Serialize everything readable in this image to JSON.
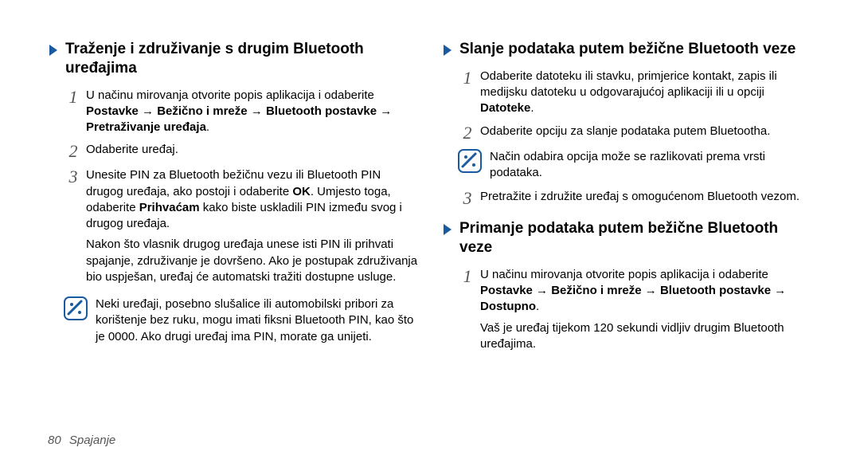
{
  "left": {
    "heading": "Traženje i združivanje s drugim Bluetooth uređajima",
    "steps": [
      {
        "num": "1",
        "body": [
          {
            "plain": "U načinu mirovanja otvorite popis aplikacija i odaberite "
          },
          {
            "bold": "Postavke"
          },
          {
            "plain": " "
          },
          {
            "arrow": "→"
          },
          {
            "plain": " "
          },
          {
            "bold": "Bežično i mreže"
          },
          {
            "plain": " "
          },
          {
            "arrow": "→"
          },
          {
            "plain": " "
          },
          {
            "bold": "Bluetooth postavke"
          },
          {
            "plain": " "
          },
          {
            "arrow": "→"
          },
          {
            "plain": " "
          },
          {
            "bold": "Pretraživanje uređaja"
          },
          {
            "plain": "."
          }
        ]
      },
      {
        "num": "2",
        "body": [
          {
            "plain": "Odaberite uređaj."
          }
        ]
      },
      {
        "num": "3",
        "body": [
          {
            "plain": "Unesite PIN za Bluetooth bežičnu vezu ili Bluetooth PIN drugog uređaja, ako postoji i odaberite "
          },
          {
            "bold": "OK"
          },
          {
            "plain": ". Umjesto toga, odaberite "
          },
          {
            "bold": "Prihvaćam"
          },
          {
            "plain": " kako biste uskladili PIN između svog i drugog uređaja."
          }
        ],
        "extra": "Nakon što vlasnik drugog uređaja unese isti PIN ili prihvati spajanje, združivanje je dovršeno. Ako je postupak združivanja bio uspješan, uređaj će automatski tražiti dostupne usluge."
      }
    ],
    "note": "Neki uređaji, posebno slušalice ili automobilski pribori za korištenje bez ruku, mogu imati fiksni Bluetooth PIN, kao što je 0000. Ako drugi uređaj ima PIN, morate ga unijeti."
  },
  "right": {
    "sectionA": {
      "heading": "Slanje podataka putem bežične Bluetooth veze",
      "steps": [
        {
          "num": "1",
          "body": [
            {
              "plain": "Odaberite datoteku ili stavku, primjerice kontakt, zapis ili medijsku datoteku u odgovarajućoj aplikaciji ili u opciji "
            },
            {
              "bold": "Datoteke"
            },
            {
              "plain": "."
            }
          ]
        },
        {
          "num": "2",
          "body": [
            {
              "plain": "Odaberite opciju za slanje podataka putem Bluetootha."
            }
          ]
        }
      ],
      "note": "Način odabira opcija može se razlikovati prema vrsti podataka.",
      "step3": {
        "num": "3",
        "body": [
          {
            "plain": "Pretražite i združite uređaj s omogućenom Bluetooth vezom."
          }
        ]
      }
    },
    "sectionB": {
      "heading": "Primanje podataka putem bežične Bluetooth veze",
      "steps": [
        {
          "num": "1",
          "body": [
            {
              "plain": "U načinu mirovanja otvorite popis aplikacija i odaberite "
            },
            {
              "bold": "Postavke"
            },
            {
              "plain": " "
            },
            {
              "arrow": "→"
            },
            {
              "plain": " "
            },
            {
              "bold": "Bežično i mreže"
            },
            {
              "plain": " "
            },
            {
              "arrow": "→"
            },
            {
              "plain": " "
            },
            {
              "bold": "Bluetooth postavke"
            },
            {
              "plain": " "
            },
            {
              "arrow": "→"
            },
            {
              "plain": " "
            },
            {
              "bold": "Dostupno"
            },
            {
              "plain": "."
            }
          ],
          "extra": "Vaš je uređaj tijekom 120 sekundi vidljiv drugim Bluetooth uređajima."
        }
      ]
    }
  },
  "footer": {
    "page": "80",
    "section": "Spajanje"
  }
}
